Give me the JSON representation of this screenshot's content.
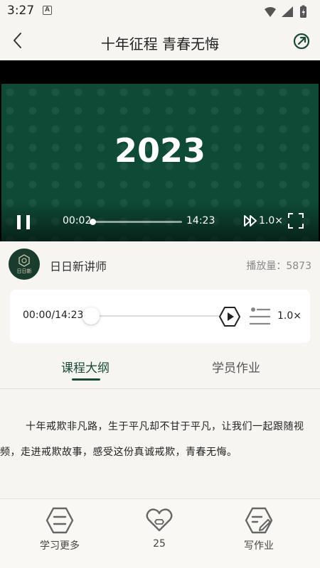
{
  "status_bar": {
    "time": "3:27",
    "notif_letter": "A"
  },
  "header": {
    "title": "十年征程 青春无悔"
  },
  "video": {
    "frame_text": "2023",
    "current_time": "00:02",
    "duration": "14:23",
    "progress": 0.002,
    "speed": "1.0×"
  },
  "teacher": {
    "name": "日日新讲师",
    "avatar_text": "日日新",
    "play_count": "播放量：5873"
  },
  "audio": {
    "time": "00:00/14:23",
    "progress": 0.0,
    "speed": "1.0×"
  },
  "tabs": [
    {
      "label": "课程大纲",
      "active": true
    },
    {
      "label": "学员作业",
      "active": false
    }
  ],
  "content": {
    "text": "十年戒欺非凡路，生于平凡却不甘于平凡，让我们一起跟随视频，走进戒欺故事，感受这份真诚戒欺，青春无悔。"
  },
  "bottom_bar": {
    "learn_more": "学习更多",
    "likes": "25",
    "write_homework": "写作业"
  },
  "colors": {
    "accent": "#1a4a37",
    "background": "#f6f5f2",
    "video_bg": "#0e4a36"
  }
}
